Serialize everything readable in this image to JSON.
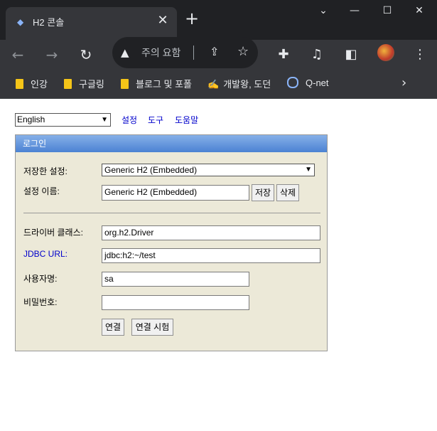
{
  "browser": {
    "tab_title": "H2 콘솔",
    "tab_close": "✕",
    "new_tab": "+",
    "omnibox_text": "주의 요함",
    "bookmarks": [
      {
        "label": "인강",
        "icon": "folder-icon"
      },
      {
        "label": "구글링",
        "icon": "folder-icon"
      },
      {
        "label": "블로그 및 포폴",
        "icon": "folder-icon"
      },
      {
        "label": "개발왕, 도던",
        "icon": "hand-icon"
      },
      {
        "label": "Q-net",
        "icon": "q-net-icon"
      }
    ]
  },
  "page": {
    "language": "English",
    "links": {
      "settings": "설정",
      "tools": "도구",
      "help": "도움말"
    },
    "panel_title": "로그인",
    "saved_settings_label": "저장한 설정:",
    "saved_settings_value": "Generic H2 (Embedded)",
    "setting_name_label": "설정 이름:",
    "setting_name_value": "Generic H2 (Embedded)",
    "save_button": "저장",
    "delete_button": "삭제",
    "driver_class_label": "드라이버 클래스:",
    "driver_class_value": "org.h2.Driver",
    "jdbc_url_label": "JDBC URL:",
    "jdbc_url_value": "jdbc:h2:~/test",
    "username_label": "사용자명:",
    "username_value": "sa",
    "password_label": "비밀번호:",
    "password_value": "",
    "connect_button": "연결",
    "test_connection_button": "연결 시험"
  },
  "colors": {
    "chrome_dark": "#202124",
    "chrome_toolbar": "#35363a",
    "panel_bg": "#ece9d8",
    "panel_header": "#4b82d3",
    "link": "#0000cc"
  }
}
